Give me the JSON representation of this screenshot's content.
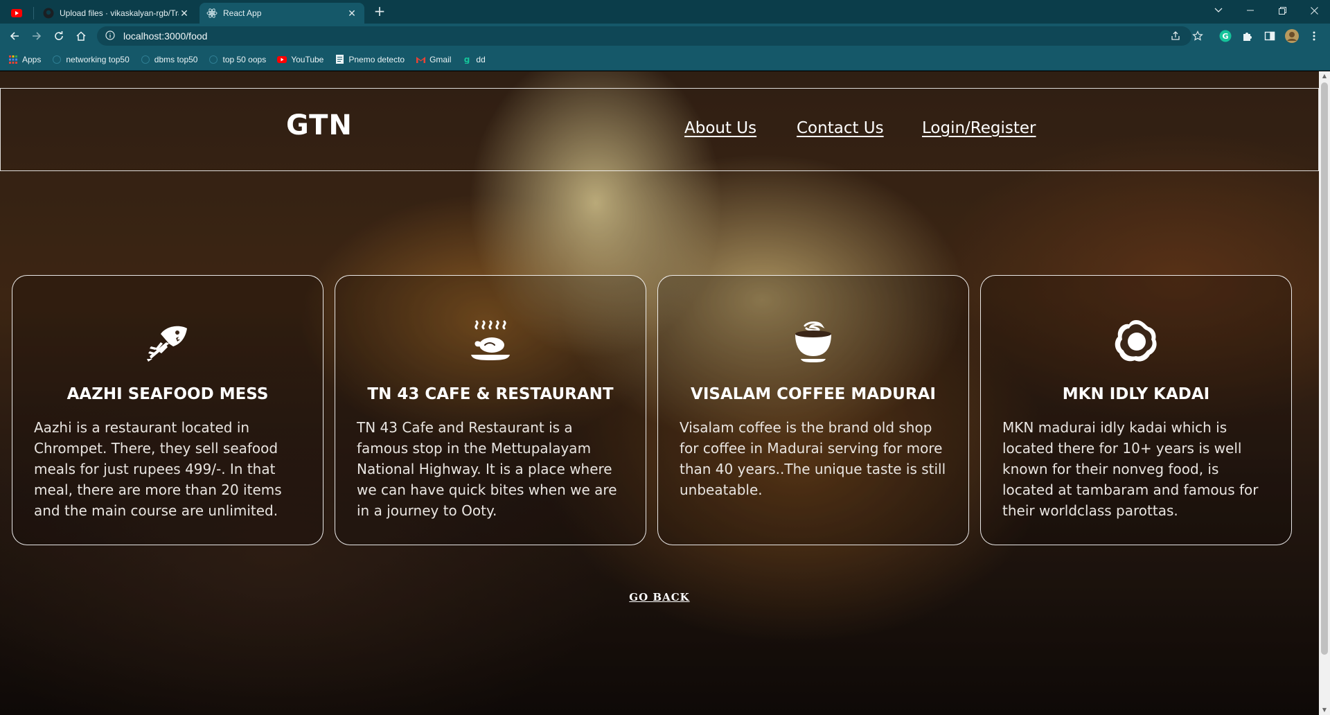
{
  "browser": {
    "tabs": [
      {
        "title": "",
        "favicon": "youtube-icon"
      },
      {
        "title": "Upload files · vikaskalyan-rgb/Tra",
        "favicon": "github-icon"
      },
      {
        "title": "React App",
        "favicon": "react-icon",
        "active": true
      }
    ],
    "url": "localhost:3000/food",
    "bookmarks": [
      {
        "label": "Apps",
        "icon": "apps-grid-icon"
      },
      {
        "label": "networking top50",
        "icon": "globe-icon"
      },
      {
        "label": "dbms top50",
        "icon": "globe-icon"
      },
      {
        "label": "top 50 oops",
        "icon": "globe-icon"
      },
      {
        "label": "YouTube",
        "icon": "youtube-icon"
      },
      {
        "label": "Pnemo detecto",
        "icon": "document-icon"
      },
      {
        "label": "Gmail",
        "icon": "gmail-icon"
      },
      {
        "label": "dd",
        "icon": "grammarly-icon"
      }
    ]
  },
  "header": {
    "logo": "GTN",
    "nav": [
      "About Us",
      "Contact Us",
      "Login/Register"
    ]
  },
  "cards": [
    {
      "icon": "fish-bone-icon",
      "title": "AAZHI SEAFOOD MESS",
      "description": "Aazhi is a restaurant located in Chrompet. There, they sell seafood meals for just rupees 499/-. In that meal, there are more than 20 items and the main course are unlimited."
    },
    {
      "icon": "roast-chicken-icon",
      "title": "TN 43 CAFE & RESTAURANT",
      "description": "TN 43 Cafe and Restaurant is a famous stop in the Mettupalayam National Highway. It is a place where we can have quick bites when we are in a journey to Ooty."
    },
    {
      "icon": "coffee-cup-icon",
      "title": "VISALAM COFFEE MADURAI",
      "description": "Visalam coffee is the brand old shop for coffee in Madurai serving for more than 40 years..The unique taste is still unbeatable."
    },
    {
      "icon": "fried-egg-icon",
      "title": "MKN IDLY KADAI",
      "description": "MKN madurai idly kadai which is located there for 10+ years is well known for their nonveg food, is located at tambaram and famous for their worldclass parottas."
    }
  ],
  "go_back": "GO BACK",
  "colors": {
    "tabstrip": "#0b3d4a",
    "toolbar": "#155869",
    "text": "#ffffff"
  }
}
